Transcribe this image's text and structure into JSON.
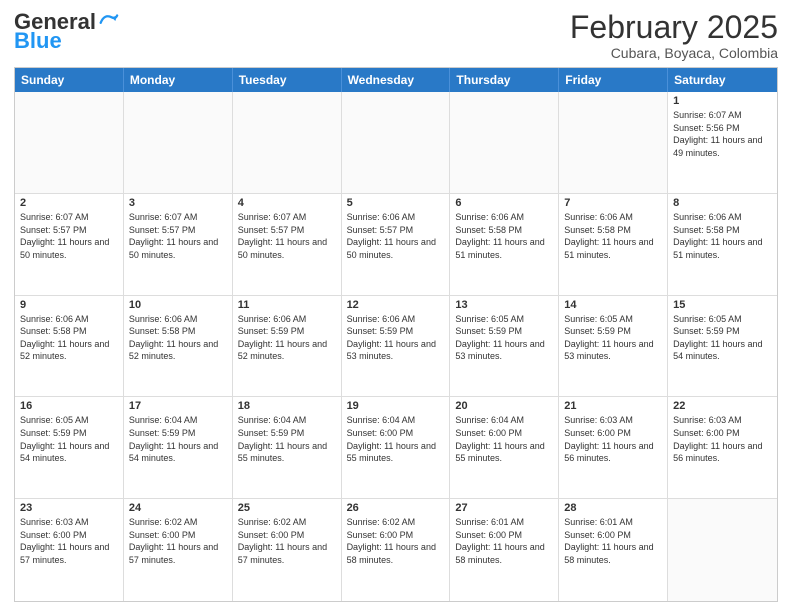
{
  "header": {
    "logo": {
      "line1": "General",
      "line2": "Blue"
    },
    "month_year": "February 2025",
    "location": "Cubara, Boyaca, Colombia"
  },
  "days_of_week": [
    "Sunday",
    "Monday",
    "Tuesday",
    "Wednesday",
    "Thursday",
    "Friday",
    "Saturday"
  ],
  "weeks": [
    [
      {
        "day": "",
        "info": ""
      },
      {
        "day": "",
        "info": ""
      },
      {
        "day": "",
        "info": ""
      },
      {
        "day": "",
        "info": ""
      },
      {
        "day": "",
        "info": ""
      },
      {
        "day": "",
        "info": ""
      },
      {
        "day": "1",
        "info": "Sunrise: 6:07 AM\nSunset: 5:56 PM\nDaylight: 11 hours and 49 minutes."
      }
    ],
    [
      {
        "day": "2",
        "info": "Sunrise: 6:07 AM\nSunset: 5:57 PM\nDaylight: 11 hours and 50 minutes."
      },
      {
        "day": "3",
        "info": "Sunrise: 6:07 AM\nSunset: 5:57 PM\nDaylight: 11 hours and 50 minutes."
      },
      {
        "day": "4",
        "info": "Sunrise: 6:07 AM\nSunset: 5:57 PM\nDaylight: 11 hours and 50 minutes."
      },
      {
        "day": "5",
        "info": "Sunrise: 6:06 AM\nSunset: 5:57 PM\nDaylight: 11 hours and 50 minutes."
      },
      {
        "day": "6",
        "info": "Sunrise: 6:06 AM\nSunset: 5:58 PM\nDaylight: 11 hours and 51 minutes."
      },
      {
        "day": "7",
        "info": "Sunrise: 6:06 AM\nSunset: 5:58 PM\nDaylight: 11 hours and 51 minutes."
      },
      {
        "day": "8",
        "info": "Sunrise: 6:06 AM\nSunset: 5:58 PM\nDaylight: 11 hours and 51 minutes."
      }
    ],
    [
      {
        "day": "9",
        "info": "Sunrise: 6:06 AM\nSunset: 5:58 PM\nDaylight: 11 hours and 52 minutes."
      },
      {
        "day": "10",
        "info": "Sunrise: 6:06 AM\nSunset: 5:58 PM\nDaylight: 11 hours and 52 minutes."
      },
      {
        "day": "11",
        "info": "Sunrise: 6:06 AM\nSunset: 5:59 PM\nDaylight: 11 hours and 52 minutes."
      },
      {
        "day": "12",
        "info": "Sunrise: 6:06 AM\nSunset: 5:59 PM\nDaylight: 11 hours and 53 minutes."
      },
      {
        "day": "13",
        "info": "Sunrise: 6:05 AM\nSunset: 5:59 PM\nDaylight: 11 hours and 53 minutes."
      },
      {
        "day": "14",
        "info": "Sunrise: 6:05 AM\nSunset: 5:59 PM\nDaylight: 11 hours and 53 minutes."
      },
      {
        "day": "15",
        "info": "Sunrise: 6:05 AM\nSunset: 5:59 PM\nDaylight: 11 hours and 54 minutes."
      }
    ],
    [
      {
        "day": "16",
        "info": "Sunrise: 6:05 AM\nSunset: 5:59 PM\nDaylight: 11 hours and 54 minutes."
      },
      {
        "day": "17",
        "info": "Sunrise: 6:04 AM\nSunset: 5:59 PM\nDaylight: 11 hours and 54 minutes."
      },
      {
        "day": "18",
        "info": "Sunrise: 6:04 AM\nSunset: 5:59 PM\nDaylight: 11 hours and 55 minutes."
      },
      {
        "day": "19",
        "info": "Sunrise: 6:04 AM\nSunset: 6:00 PM\nDaylight: 11 hours and 55 minutes."
      },
      {
        "day": "20",
        "info": "Sunrise: 6:04 AM\nSunset: 6:00 PM\nDaylight: 11 hours and 55 minutes."
      },
      {
        "day": "21",
        "info": "Sunrise: 6:03 AM\nSunset: 6:00 PM\nDaylight: 11 hours and 56 minutes."
      },
      {
        "day": "22",
        "info": "Sunrise: 6:03 AM\nSunset: 6:00 PM\nDaylight: 11 hours and 56 minutes."
      }
    ],
    [
      {
        "day": "23",
        "info": "Sunrise: 6:03 AM\nSunset: 6:00 PM\nDaylight: 11 hours and 57 minutes."
      },
      {
        "day": "24",
        "info": "Sunrise: 6:02 AM\nSunset: 6:00 PM\nDaylight: 11 hours and 57 minutes."
      },
      {
        "day": "25",
        "info": "Sunrise: 6:02 AM\nSunset: 6:00 PM\nDaylight: 11 hours and 57 minutes."
      },
      {
        "day": "26",
        "info": "Sunrise: 6:02 AM\nSunset: 6:00 PM\nDaylight: 11 hours and 58 minutes."
      },
      {
        "day": "27",
        "info": "Sunrise: 6:01 AM\nSunset: 6:00 PM\nDaylight: 11 hours and 58 minutes."
      },
      {
        "day": "28",
        "info": "Sunrise: 6:01 AM\nSunset: 6:00 PM\nDaylight: 11 hours and 58 minutes."
      },
      {
        "day": "",
        "info": ""
      }
    ]
  ]
}
